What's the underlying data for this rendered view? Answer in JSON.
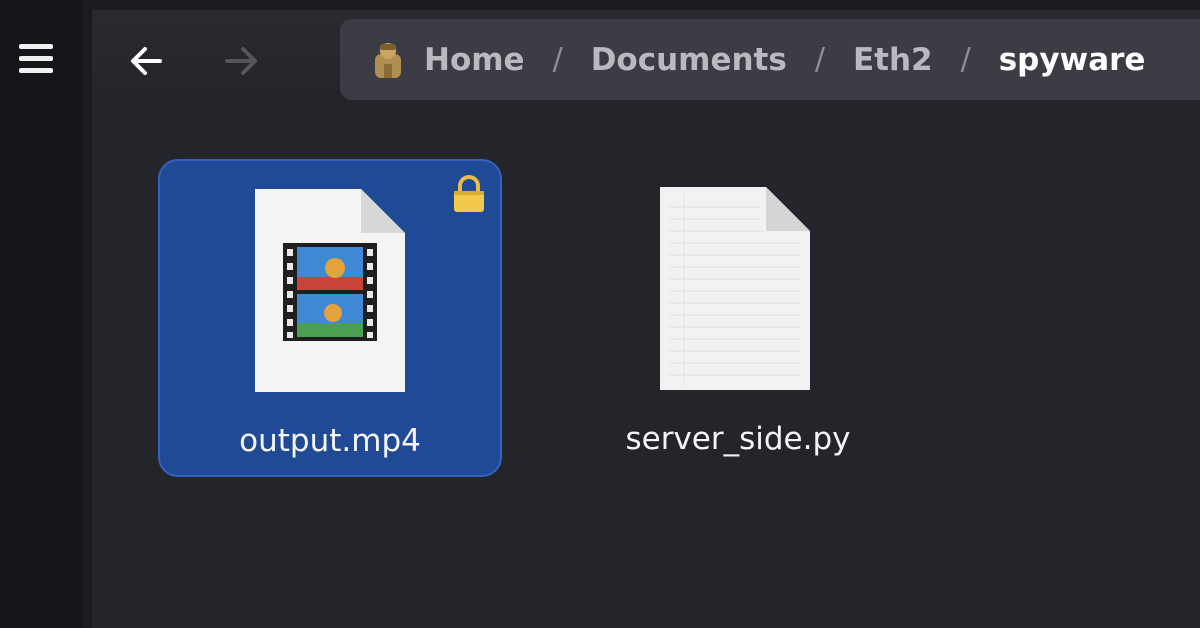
{
  "window": {
    "menu_icon": "hamburger-menu-icon",
    "back_icon": "arrow-left-icon",
    "forward_icon": "arrow-right-icon"
  },
  "breadcrumb": {
    "home_icon": "home-user-icon",
    "items": [
      "Home",
      "Documents",
      "Eth2",
      "spyware"
    ],
    "separator": "/",
    "current": "spyware"
  },
  "files": [
    {
      "name": "output.mp4",
      "icon": "video-file-icon",
      "selected": true,
      "locked": true,
      "badge_icon": "lock-icon"
    },
    {
      "name": "server_side.py",
      "icon": "text-file-icon",
      "selected": false,
      "locked": false
    }
  ],
  "colors": {
    "background": "#23252b",
    "sidebar": "#141518",
    "breadcrumb_bg": "#3b3c44",
    "selection": "#214a96",
    "lock": "#f2c94c"
  }
}
